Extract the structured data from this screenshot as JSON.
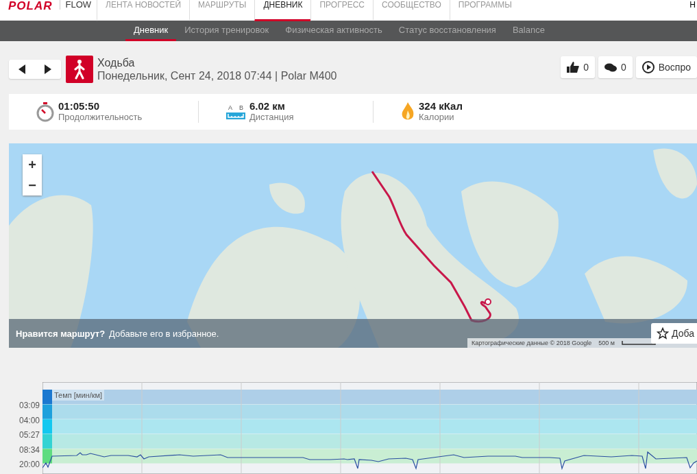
{
  "header": {
    "logo": "POLAR",
    "product": "FLOW",
    "nav": [
      {
        "label": "ЛЕНТА НОВОСТЕЙ",
        "selected": false
      },
      {
        "label": "МАРШРУТЫ",
        "selected": false
      },
      {
        "label": "ДНЕВНИК",
        "selected": true
      },
      {
        "label": "ПРОГРЕСС",
        "selected": false
      },
      {
        "label": "СООБЩЕСТВО",
        "selected": false
      },
      {
        "label": "ПРОГРАММЫ",
        "selected": false
      }
    ],
    "right": "Н"
  },
  "subnav": [
    {
      "label": "Дневник",
      "selected": true
    },
    {
      "label": "История тренировок",
      "selected": false
    },
    {
      "label": "Физическая активность",
      "selected": false
    },
    {
      "label": "Статус восстановления",
      "selected": false
    },
    {
      "label": "Balance",
      "selected": false
    }
  ],
  "session": {
    "sport": "Ходьба",
    "details": "Понедельник, Сент 24, 2018 07:44 | Polar M400",
    "likes": "0",
    "comments": "0",
    "replay": "Воспро"
  },
  "stats": [
    {
      "kind": "duration",
      "value": "01:05:50",
      "label": "Продолжительность"
    },
    {
      "kind": "distance",
      "value": "6.02 км",
      "label": "Дистанция",
      "marks": [
        "A",
        "B"
      ]
    },
    {
      "kind": "calories",
      "value": "324 кКал",
      "label": "Калории"
    }
  ],
  "map": {
    "zoom": [
      "+",
      "−"
    ],
    "prompt_bold": "Нравится маршрут?",
    "prompt": "Добавьте его в избранное.",
    "favorite": "Доба",
    "attribution": "Картографические данные © 2018 Google",
    "scale": "500 м"
  },
  "chart": {
    "title": "Темп [мин/км]",
    "y_labels": [
      "03:09",
      "04:00",
      "05:27",
      "08:34",
      "20:00"
    ]
  }
}
